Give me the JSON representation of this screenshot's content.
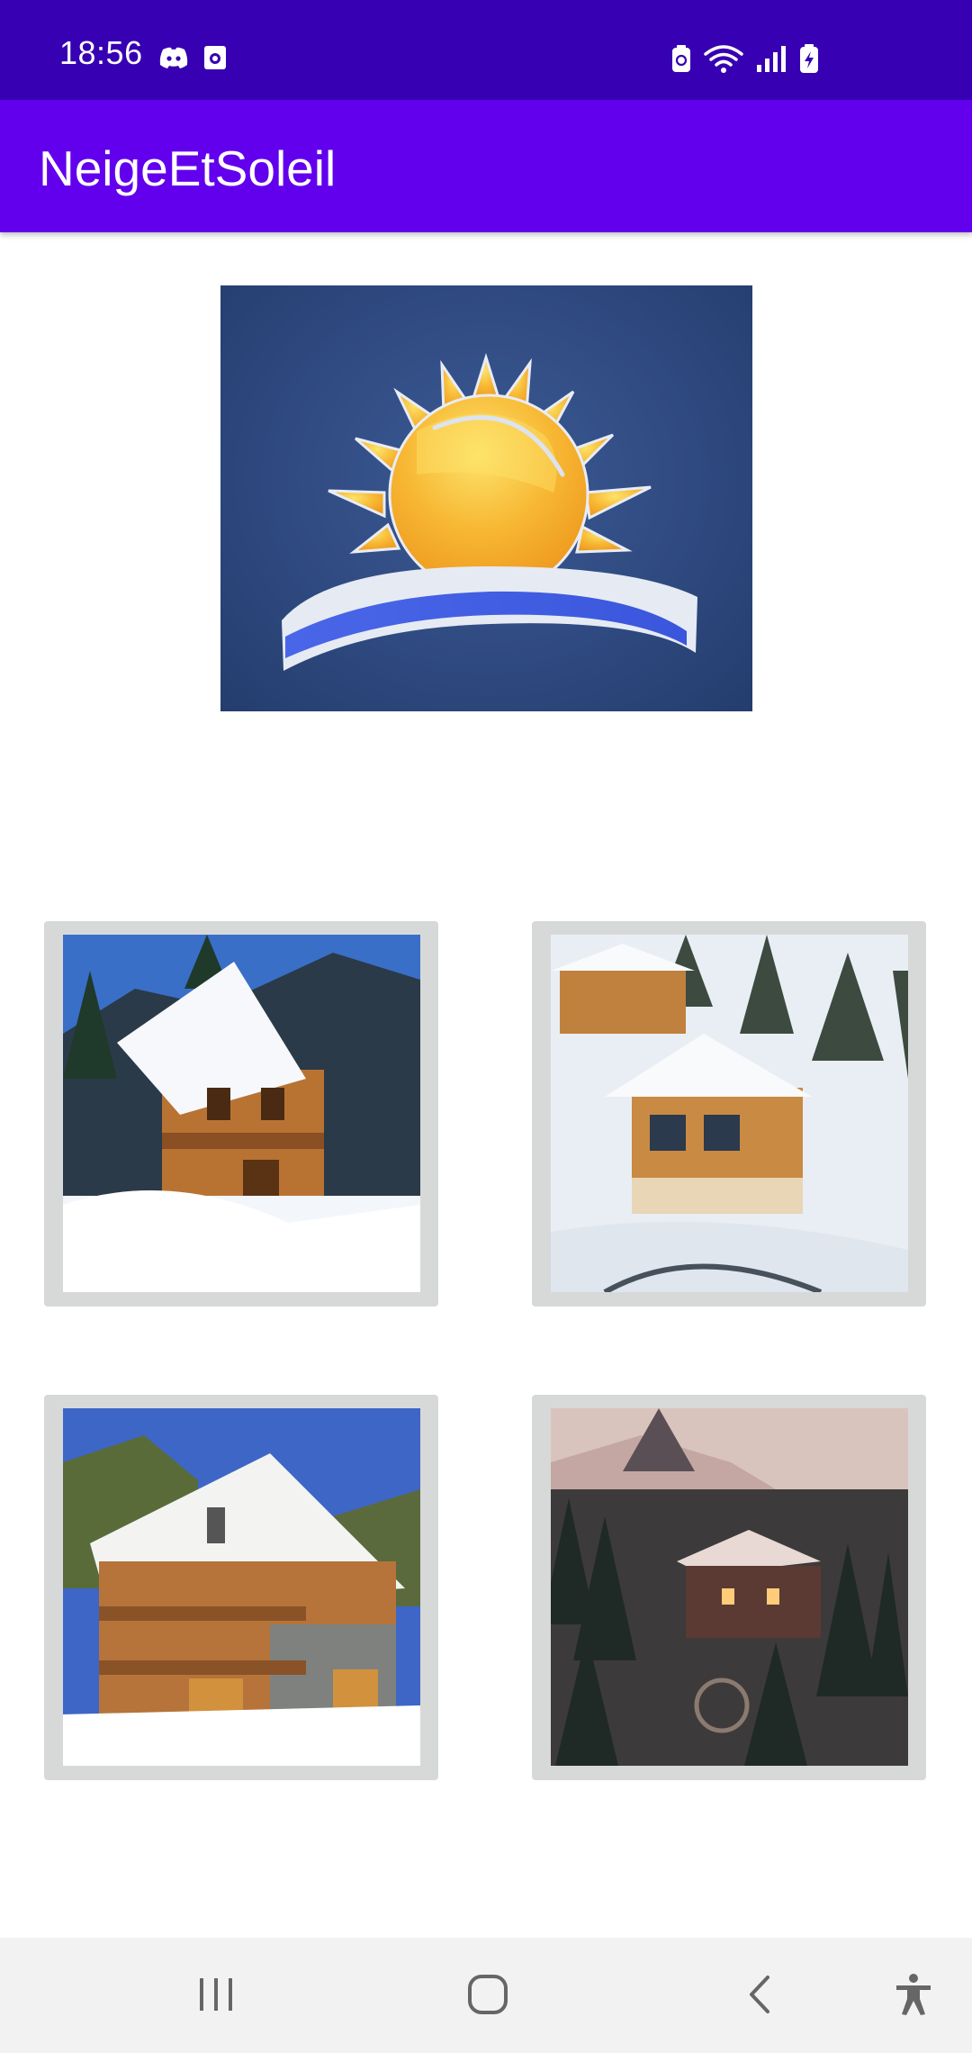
{
  "status_bar": {
    "time": "18:56",
    "left_icons": [
      "discord-icon",
      "camera-notification-icon"
    ],
    "right_icons": [
      "battery-saver-icon",
      "wifi-icon",
      "signal-icon",
      "battery-charging-icon"
    ]
  },
  "app_bar": {
    "title": "NeigeEtSoleil"
  },
  "gallery": {
    "items": [
      {
        "icon": "chalet-photo-1"
      },
      {
        "icon": "chalet-photo-2"
      },
      {
        "icon": "chalet-photo-3"
      },
      {
        "icon": "chalet-photo-4"
      }
    ]
  },
  "nav_bar": {
    "buttons": [
      "recents-icon",
      "home-icon",
      "back-icon",
      "accessibility-icon"
    ]
  },
  "colors": {
    "status_bar": "#3700b3",
    "app_bar": "#6200ee",
    "thumb_frame": "#d7d9d9",
    "nav_bar": "#f2f2f2"
  }
}
